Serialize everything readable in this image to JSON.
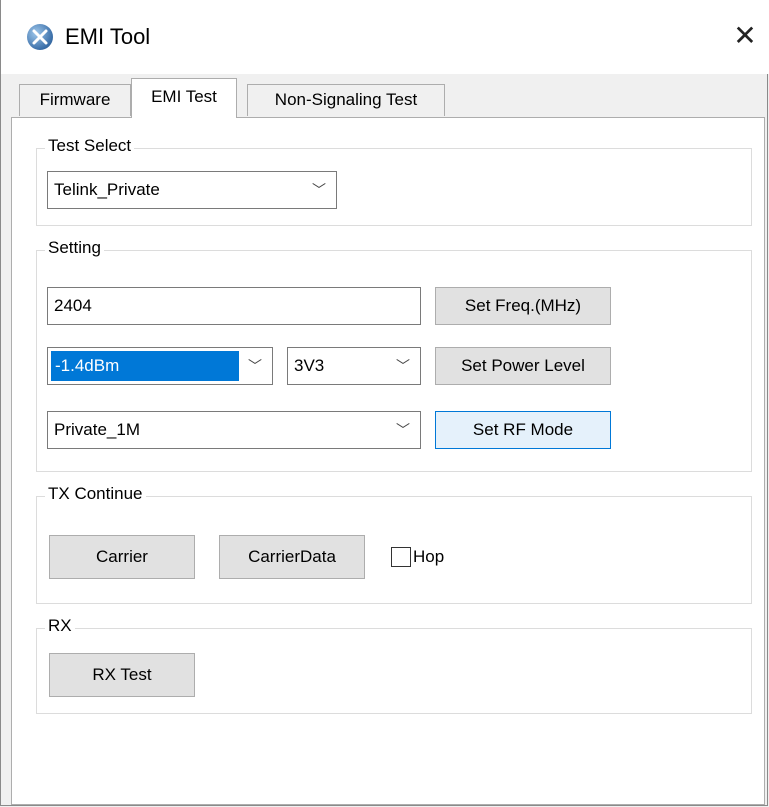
{
  "window": {
    "title": "EMI Tool",
    "close_glyph": "✕",
    "icon": "app-globe-icon"
  },
  "tabs": [
    {
      "label": "Firmware",
      "active": false
    },
    {
      "label": "EMI Test",
      "active": true
    },
    {
      "label": "Non-Signaling Test",
      "active": false
    }
  ],
  "test_select": {
    "title": "Test Select",
    "value": "Telink_Private"
  },
  "setting": {
    "title": "Setting",
    "freq_value": "2404",
    "set_freq_label": "Set Freq.(MHz)",
    "power_value": "-1.4dBm",
    "voltage_value": "3V3",
    "set_power_label": "Set Power Level",
    "rf_mode_value": "Private_1M",
    "set_rf_mode_label": "Set RF Mode"
  },
  "tx_continue": {
    "title": "TX Continue",
    "carrier_label": "Carrier",
    "carrier_data_label": "CarrierData",
    "hop_label": "Hop",
    "hop_checked": false
  },
  "rx": {
    "title": "RX",
    "rx_test_label": "RX Test"
  },
  "dropdown_arrow": "﹀",
  "colors": {
    "selection": "#0078d7",
    "focus_border": "#0078d7"
  }
}
